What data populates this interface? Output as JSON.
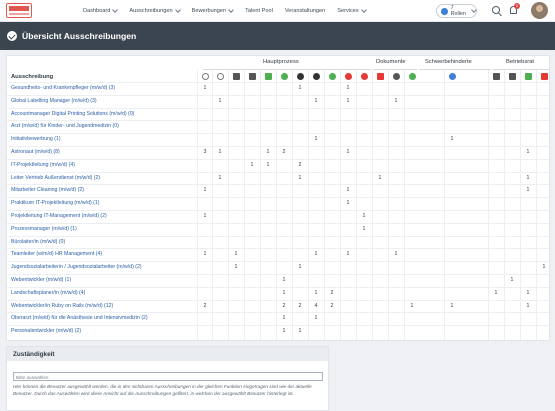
{
  "nav": {
    "items": [
      "Dashboard",
      "Ausschreibungen",
      "Bewerbungen",
      "Talent Pool",
      "Veranstaltungen",
      "Services"
    ],
    "roles_label": "7 Rollen",
    "notification_count": "2"
  },
  "page": {
    "title": "Übersicht Ausschreibungen"
  },
  "table": {
    "groups": [
      {
        "label": "Hauptprozess"
      },
      {
        "label": "Dokumente"
      },
      {
        "label": "Schwerbehinderte"
      },
      {
        "label": "Betriebsrat"
      }
    ],
    "column_header": "Ausschreibung",
    "status_icons": [
      {
        "icon": "smiley-outline-icon",
        "color": "#7a7a7a"
      },
      {
        "icon": "person-outline-icon",
        "color": "#7a7a7a"
      },
      {
        "icon": "document-icon",
        "color": "#555555"
      },
      {
        "icon": "document-icon",
        "color": "#555555"
      },
      {
        "icon": "document-icon",
        "color": "#4caf50"
      },
      {
        "icon": "person-icon",
        "color": "#4caf50"
      },
      {
        "icon": "circle-icon",
        "color": "#333333"
      },
      {
        "icon": "circle-icon",
        "color": "#333333"
      },
      {
        "icon": "chat-bubble-icon",
        "color": "#4caf50"
      },
      {
        "icon": "chat-bubble-icon",
        "color": "#e53935"
      },
      {
        "icon": "circle-icon",
        "color": "#e53935"
      },
      {
        "icon": "document-icon",
        "color": "#e53935"
      },
      {
        "icon": "circle-icon",
        "color": "#555555"
      },
      {
        "icon": "circle-icon",
        "color": "#4caf50"
      },
      {
        "icon": "wheelchair-icon",
        "color": "#3d7fd8"
      },
      {
        "icon": "document-icon",
        "color": "#555555"
      },
      {
        "icon": "document-icon",
        "color": "#555555"
      },
      {
        "icon": "document-icon",
        "color": "#4caf50"
      },
      {
        "icon": "document-icon",
        "color": "#e53935"
      }
    ],
    "rows": [
      {
        "label": "Gesundheits- und Krankenpfleger (m/w/d) (3)",
        "cells": [
          "1",
          "",
          "",
          "",
          "",
          "",
          "1",
          "",
          "",
          "1",
          "",
          "",
          "",
          "",
          "",
          "",
          "",
          "",
          ""
        ]
      },
      {
        "label": "Global Labelling Manager (m/w/d) (3)",
        "cells": [
          "",
          "1",
          "",
          "",
          "",
          "",
          "",
          "1",
          "",
          "1",
          "",
          "",
          "1",
          "",
          "",
          "",
          "",
          "",
          ""
        ]
      },
      {
        "label": "Accountmanager Digital Printing Solutions (m/w/d) (0)",
        "cells": [
          "",
          "",
          "",
          "",
          "",
          "",
          "",
          "",
          "",
          "",
          "",
          "",
          "",
          "",
          "",
          "",
          "",
          "",
          ""
        ]
      },
      {
        "label": "Arzt (m/w/d) für Kinder- und Jugendmedizin (0)",
        "cells": [
          "",
          "",
          "",
          "",
          "",
          "",
          "",
          "",
          "",
          "",
          "",
          "",
          "",
          "",
          "",
          "",
          "",
          "",
          ""
        ]
      },
      {
        "label": "Initiativbewerbung (1)",
        "cells": [
          "",
          "",
          "",
          "",
          "",
          "",
          "",
          "1",
          "",
          "",
          "",
          "",
          "",
          "",
          "1",
          "",
          "",
          "",
          ""
        ]
      },
      {
        "label": "Astronaut (m/w/d) (8)",
        "cells": [
          "3",
          "1",
          "",
          "",
          "1",
          "2",
          "",
          "",
          "",
          "1",
          "",
          "",
          "",
          "",
          "",
          "",
          "",
          "1",
          ""
        ]
      },
      {
        "label": "IT-Projektleitung (m/w/d) (4)",
        "cells": [
          "",
          "",
          "",
          "1",
          "1",
          "",
          "2",
          "",
          "",
          "",
          "",
          "",
          "",
          "",
          "",
          "",
          "",
          "",
          ""
        ]
      },
      {
        "label": "Leiter Vertrieb Außendienst (m/w/d) (2)",
        "cells": [
          "",
          "1",
          "",
          "",
          "",
          "",
          "1",
          "",
          "",
          "",
          "",
          "1",
          "",
          "",
          "",
          "",
          "",
          "1",
          ""
        ]
      },
      {
        "label": "Mitarbeiter Cleaning (m/w/d) (2)",
        "cells": [
          "1",
          "",
          "",
          "",
          "",
          "",
          "",
          "",
          "",
          "1",
          "",
          "",
          "",
          "",
          "",
          "",
          "",
          "1",
          ""
        ]
      },
      {
        "label": "Praktikum IT-Projektleitung (m/w/d) (1)",
        "cells": [
          "",
          "",
          "",
          "",
          "",
          "",
          "",
          "",
          "",
          "1",
          "",
          "",
          "",
          "",
          "",
          "",
          "",
          "",
          ""
        ]
      },
      {
        "label": "Projektleitung IT-Management (m/w/d) (2)",
        "cells": [
          "1",
          "",
          "",
          "",
          "",
          "",
          "",
          "",
          "",
          "",
          "1",
          "",
          "",
          "",
          "",
          "",
          "",
          "",
          ""
        ]
      },
      {
        "label": "Prozessmanager (m/w/d) (1)",
        "cells": [
          "",
          "",
          "",
          "",
          "",
          "",
          "",
          "",
          "",
          "",
          "1",
          "",
          "",
          "",
          "",
          "",
          "",
          "",
          ""
        ]
      },
      {
        "label": "Bürolaiter/in (m/w/d) (0)",
        "cells": [
          "",
          "",
          "",
          "",
          "",
          "",
          "",
          "",
          "",
          "",
          "",
          "",
          "",
          "",
          "",
          "",
          "",
          "",
          ""
        ]
      },
      {
        "label": "Teamleiter (w/m/d) HR Management (4)",
        "cells": [
          "1",
          "",
          "1",
          "",
          "",
          "",
          "",
          "1",
          "",
          "1",
          "",
          "",
          "1",
          "",
          "",
          "",
          "",
          "",
          ""
        ]
      },
      {
        "label": "Jugendsozialarbeiterin / Jugendsozialarbeiter (m/w/d) (2)",
        "cells": [
          "",
          "",
          "1",
          "",
          "",
          "",
          "1",
          "",
          "",
          "",
          "",
          "",
          "",
          "",
          "",
          "",
          "",
          "",
          "1"
        ]
      },
      {
        "label": "Webentwickler (m/w/d) (1)",
        "cells": [
          "",
          "",
          "",
          "",
          "",
          "1",
          "",
          "",
          "",
          "",
          "",
          "",
          "",
          "",
          "",
          "",
          "1",
          "",
          ""
        ]
      },
      {
        "label": "Landschaftsplaner/in (m/w/d) (4)",
        "cells": [
          "",
          "",
          "",
          "",
          "",
          "1",
          "",
          "1",
          "2",
          "",
          "",
          "",
          "",
          "",
          "",
          "1",
          "",
          "1",
          ""
        ]
      },
      {
        "label": "Webentwickler/in Ruby on Rails (m/w/d) (12)",
        "cells": [
          "2",
          "",
          "",
          "",
          "",
          "2",
          "2",
          "4",
          "2",
          "",
          "",
          "",
          "",
          "1",
          "1",
          "",
          "",
          "1",
          ""
        ]
      },
      {
        "label": "Oberarzt (m/w/d) für die Anästhesie und Intensivmedizin (2)",
        "cells": [
          "",
          "",
          "",
          "",
          "",
          "1",
          "",
          "1",
          "",
          "",
          "",
          "",
          "",
          "",
          "",
          "",
          "",
          "",
          ""
        ]
      },
      {
        "label": "Personalentwickler (m/w/d) (2)",
        "cells": [
          "",
          "",
          "",
          "",
          "",
          "1",
          "1",
          "",
          "",
          "",
          "",
          "",
          "",
          "",
          "",
          "",
          "",
          "",
          ""
        ]
      }
    ]
  },
  "zustaendigkeit": {
    "title": "Zuständigkeit",
    "placeholder": "Bitte auswählen",
    "help": "Hier können die Benutzer ausgewählt werden, die in den sichtbaren Ausschreibungen in der gleichen Funktion eingetragen sind wie der aktuelle Benutzer. Durch das Auswählen wird diese Ansicht auf die Ausschreibungen gefiltert, in welchen der ausgewählt Benutzer hinterlegt ist."
  }
}
